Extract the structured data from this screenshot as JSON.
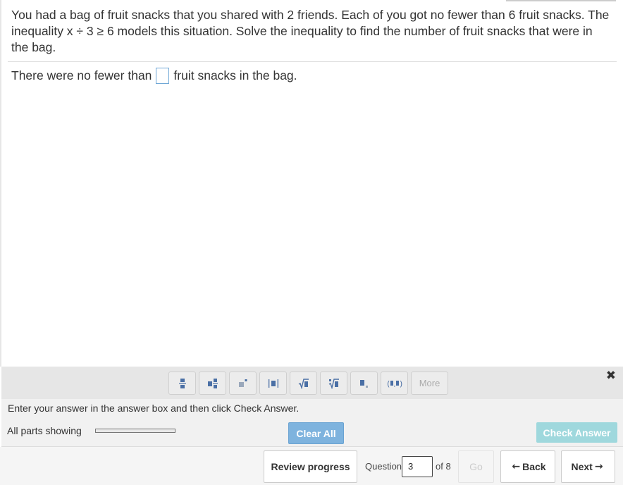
{
  "question": {
    "text": "You had a bag of fruit snacks that you shared with 2 friends. Each of you got no fewer than 6 fruit snacks. The inequality x ÷ 3 ≥ 6 models this situation. Solve the inequality to find the number of fruit snacks that were in the bag."
  },
  "answer": {
    "prefix": "There were no fewer than",
    "suffix": "fruit snacks in the bag."
  },
  "palette": {
    "buttons": [
      {
        "name": "fraction-icon",
        "glyph": "▪̲▪"
      },
      {
        "name": "mixed-number-icon",
        "glyph": "▪▫"
      },
      {
        "name": "exponent-icon",
        "glyph": "▪˙"
      },
      {
        "name": "absolute-value-icon",
        "glyph": "|▪|"
      },
      {
        "name": "square-root-icon",
        "glyph": "√▪"
      },
      {
        "name": "nth-root-icon",
        "glyph": "ⁿ√▪"
      },
      {
        "name": "subscript-icon",
        "glyph": "▪."
      },
      {
        "name": "ordered-pair-icon",
        "glyph": "(▪,▪)"
      }
    ],
    "more_label": "More"
  },
  "instruction": "Enter your answer in the answer box and then click Check Answer.",
  "parts": {
    "label": "All parts showing",
    "progress": 0
  },
  "actions": {
    "clear_all": "Clear All",
    "check_answer": "Check Answer"
  },
  "footer": {
    "review_progress": "Review progress",
    "question_label": "Question",
    "question_number": "3",
    "of_label": "of 8",
    "go_label": "Go",
    "back_label": "Back",
    "next_label": "Next"
  },
  "colors": {
    "clear_button": "#7eb3de",
    "check_button": "#9fd8dd",
    "answer_box_border": "#6fa7d6"
  }
}
